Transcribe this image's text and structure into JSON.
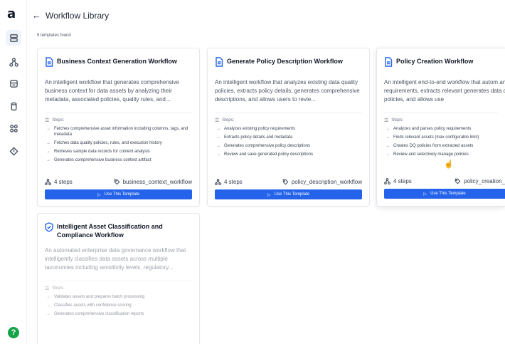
{
  "app": {
    "logo_letter": "a",
    "help_label": "?"
  },
  "header": {
    "back_arrow": "←",
    "title": "Workflow Library",
    "template_count": "5 templates found"
  },
  "sidebar": {
    "items": [
      {
        "icon": "database-stack-icon"
      },
      {
        "icon": "workflow-graph-icon"
      },
      {
        "icon": "storage-icon"
      },
      {
        "icon": "cylinder-icon"
      },
      {
        "icon": "grid-icon"
      },
      {
        "icon": "alert-diamond-icon"
      }
    ]
  },
  "steps_label": "Steps:",
  "use_button_label": "Use This Template",
  "cards": [
    {
      "title": "Business Context Generation Workflow",
      "description": "An intelligent workflow that generates comprehensive business context for data assets by analyzing their metadata, associated policies, quality rules, and...",
      "steps": [
        "Fetches comprehensive asset information including columns, tags, and metadata",
        "Fetches data quality policies, rules, and execution history",
        "Retrieves sample data records for content analysis",
        "Generates comprehensive business context artifact"
      ],
      "step_count": "4 steps",
      "tag": "business_context_workflow"
    },
    {
      "title": "Generate Policy Description Workflow",
      "description": "An intelligent workflow that analyzes existing data quality policies, extracts policy details, generates comprehensive descriptions, and allows users to revie...",
      "steps": [
        "Analyzes existing policy requirements",
        "Extracts policy details and metadata",
        "Generates comprehensive policy descriptions",
        "Review and save generated policy descriptions"
      ],
      "step_count": "4 steps",
      "tag": "policy_description_workflow"
    },
    {
      "title": "Policy Creation Workflow",
      "description": "An intelligent end-to-end workflow that autom analyzes policy requirements, extracts relevant generates data quality policies, and allows use",
      "steps": [
        "Analyzes and parses policy requirements",
        "Finds relevant assets (max configurable limit)",
        "Creates DQ policies from extracted assets",
        "Review and selectively manage policies"
      ],
      "step_count": "4 steps",
      "tag": "policy_creation_"
    },
    {
      "title": "Intelligent Asset Classification and Compliance Workflow",
      "description": "An automated enterprise data governance workflow that intelligently classifies data assets across multiple taxonomies including sensitivity levels, regulatory...",
      "steps": [
        "Validates assets and prepares batch processing",
        "Classifies assets with confidence scoring",
        "Generates comprehensive classification reports"
      ]
    }
  ]
}
